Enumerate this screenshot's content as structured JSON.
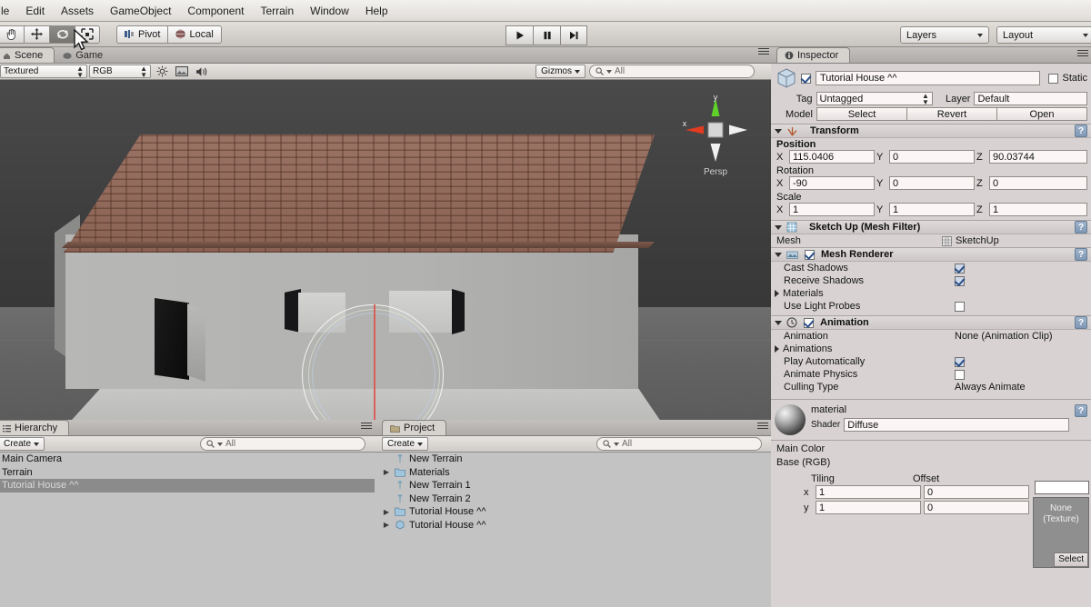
{
  "menubar": {
    "items": [
      "le",
      "Edit",
      "Assets",
      "GameObject",
      "Component",
      "Terrain",
      "Window",
      "Help"
    ]
  },
  "toolbar": {
    "tools": [
      "hand-tool",
      "move-tool",
      "rotate-tool",
      "scale-tool"
    ],
    "active_tool": "rotate-tool",
    "pivot_label": "Pivot",
    "local_label": "Local",
    "play_label": "play",
    "pause_label": "pause",
    "step_label": "step",
    "layers_label": "Layers",
    "layout_label": "Layout"
  },
  "scene": {
    "tab_label": "Scene",
    "game_tab_label": "Game",
    "draw_mode": "Textured",
    "render_mode": "RGB",
    "gizmos_label": "Gizmos",
    "search_placeholder": "All",
    "axis": {
      "x": "x",
      "y": "y"
    },
    "persp_label": "Persp"
  },
  "hierarchy": {
    "tab_label": "Hierarchy",
    "create_label": "Create",
    "search_placeholder": "All",
    "items": [
      {
        "label": "Main Camera",
        "selected": false,
        "expandable": false
      },
      {
        "label": "Terrain",
        "selected": false,
        "expandable": false
      },
      {
        "label": "Tutorial House ^^",
        "selected": true,
        "expandable": false
      }
    ]
  },
  "project": {
    "tab_label": "Project",
    "create_label": "Create",
    "search_placeholder": "All",
    "items": [
      {
        "label": "New Terrain",
        "icon": "terrain-icon",
        "expandable": false
      },
      {
        "label": "Materials",
        "icon": "folder-icon",
        "expandable": true
      },
      {
        "label": "New Terrain 1",
        "icon": "terrain-icon",
        "expandable": false
      },
      {
        "label": "New Terrain 2",
        "icon": "terrain-icon",
        "expandable": false
      },
      {
        "label": "Tutorial House ^^",
        "icon": "folder-icon",
        "expandable": true
      },
      {
        "label": "Tutorial House ^^",
        "icon": "prefab-icon",
        "expandable": true
      }
    ]
  },
  "inspector": {
    "tab_label": "Inspector",
    "object_name": "Tutorial House ^^",
    "object_enabled": true,
    "static_label": "Static",
    "static_checked": false,
    "tag_label": "Tag",
    "tag_value": "Untagged",
    "layer_label": "Layer",
    "layer_value": "Default",
    "model_label": "Model",
    "model_buttons": [
      "Select",
      "Revert",
      "Open"
    ],
    "transform": {
      "title": "Transform",
      "position_label": "Position",
      "rotation_label": "Rotation",
      "scale_label": "Scale",
      "position": {
        "x": "115.0406",
        "y": "0",
        "z": "90.03744"
      },
      "rotation": {
        "x": "-90",
        "y": "0",
        "z": "0"
      },
      "scale": {
        "x": "1",
        "y": "1",
        "z": "1"
      }
    },
    "mesh_filter": {
      "title": "Sketch Up (Mesh Filter)",
      "mesh_label": "Mesh",
      "mesh_value": "SketchUp"
    },
    "mesh_renderer": {
      "title": "Mesh Renderer",
      "enabled": true,
      "rows": [
        {
          "label": "Cast Shadows",
          "type": "checkbox",
          "value": true
        },
        {
          "label": "Receive Shadows",
          "type": "checkbox",
          "value": true
        },
        {
          "label": "Materials",
          "type": "foldout",
          "value": ""
        },
        {
          "label": "Use Light Probes",
          "type": "checkbox",
          "value": false
        }
      ]
    },
    "animation": {
      "title": "Animation",
      "enabled": true,
      "rows": [
        {
          "label": "Animation",
          "type": "text",
          "value": "None (Animation Clip)"
        },
        {
          "label": "Animations",
          "type": "foldout",
          "value": ""
        },
        {
          "label": "Play Automatically",
          "type": "checkbox",
          "value": true
        },
        {
          "label": "Animate Physics",
          "type": "checkbox",
          "value": false
        },
        {
          "label": "Culling Type",
          "type": "text",
          "value": "Always Animate"
        }
      ]
    },
    "material": {
      "name": "material",
      "shader_label": "Shader",
      "shader_value": "Diffuse",
      "main_color_label": "Main Color",
      "base_rgb_label": "Base (RGB)",
      "tiling_label": "Tiling",
      "offset_label": "Offset",
      "texture_none_label": "None\n(Texture)",
      "texture_select_label": "Select",
      "rows": [
        {
          "axis": "x",
          "tiling": "1",
          "offset": "0"
        },
        {
          "axis": "y",
          "tiling": "1",
          "offset": "0"
        }
      ]
    }
  }
}
